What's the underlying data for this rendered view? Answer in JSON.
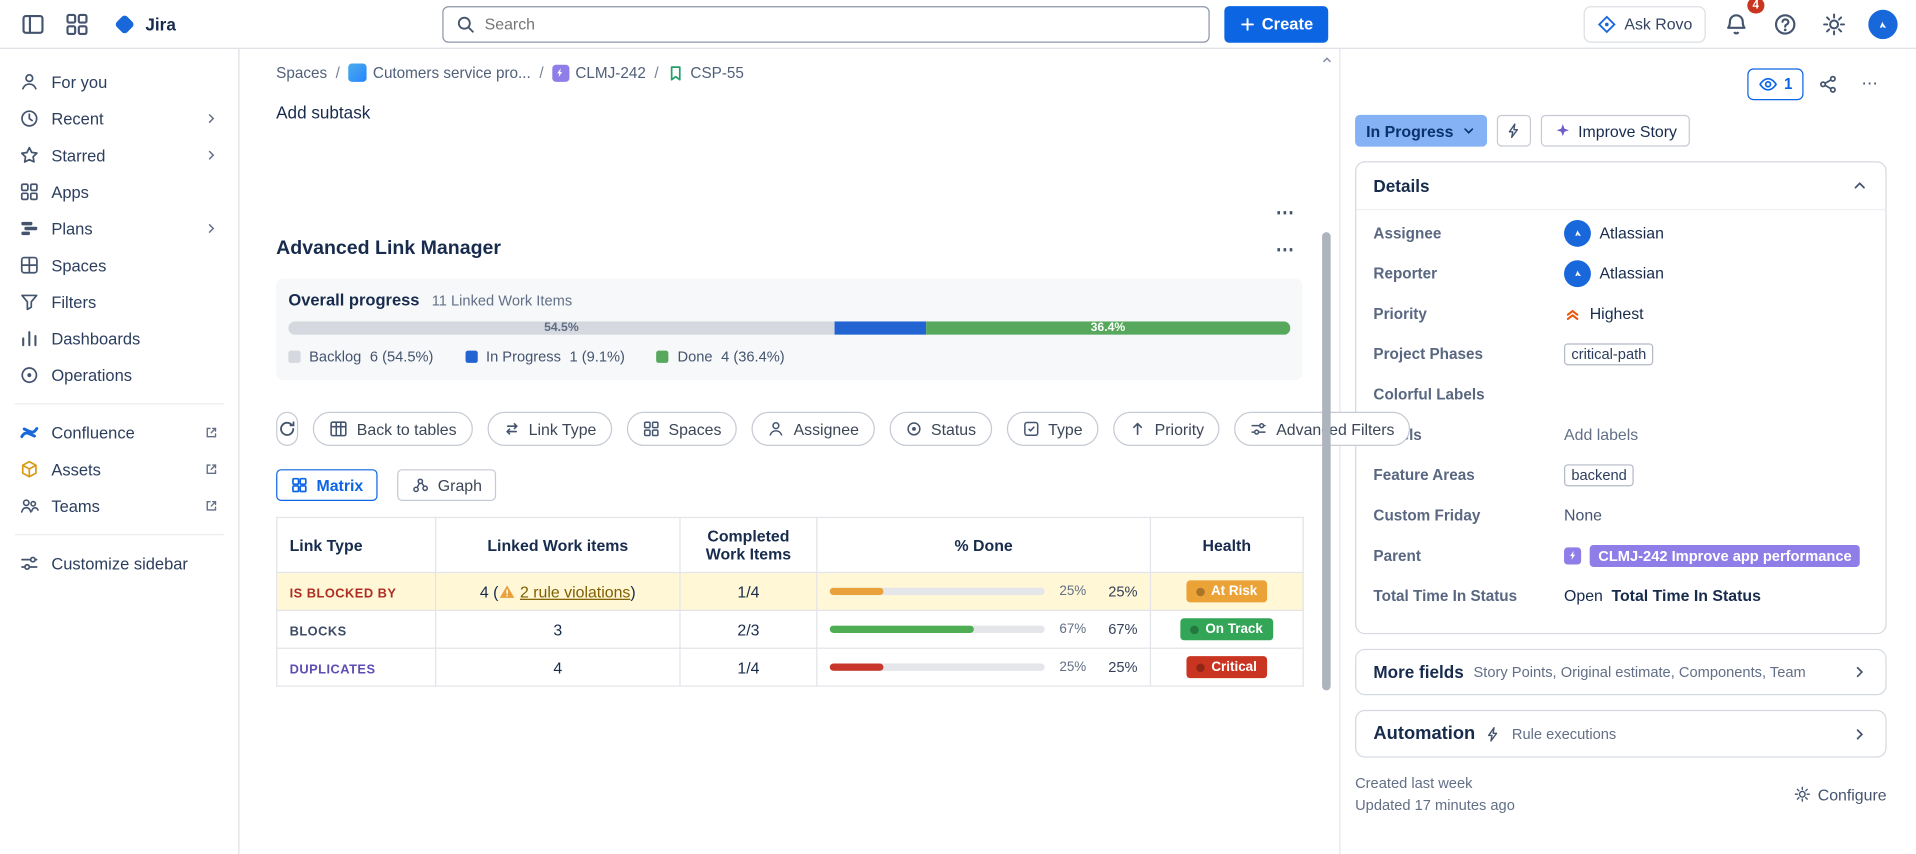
{
  "topbar": {
    "app_name": "Jira",
    "search_placeholder": "Search",
    "create_label": "Create",
    "ask_rovo_label": "Ask Rovo",
    "notification_count": "4"
  },
  "sidebar": {
    "items": [
      {
        "label": "For you"
      },
      {
        "label": "Recent"
      },
      {
        "label": "Starred"
      },
      {
        "label": "Apps"
      },
      {
        "label": "Plans"
      },
      {
        "label": "Spaces"
      },
      {
        "label": "Filters"
      },
      {
        "label": "Dashboards"
      },
      {
        "label": "Operations"
      }
    ],
    "apps": [
      {
        "label": "Confluence"
      },
      {
        "label": "Assets"
      },
      {
        "label": "Teams"
      }
    ],
    "customize_label": "Customize sidebar"
  },
  "breadcrumb": {
    "items": [
      "Spaces",
      "Cutomers service pro...",
      "CLMJ-242",
      "CSP-55"
    ]
  },
  "main": {
    "add_subtask_label": "Add subtask",
    "section_title": "Advanced Link Manager",
    "progress": {
      "title": "Overall progress",
      "count_label": "11 Linked Work Items",
      "segments": [
        {
          "name": "Backlog",
          "pct": 54.5,
          "label": "54.5%",
          "color": "#d5d9df",
          "label_color": "#5e6c84"
        },
        {
          "name": "In Progress",
          "pct": 9.1,
          "label": "",
          "color": "#2264d1",
          "label_color": "#ffffff"
        },
        {
          "name": "Done",
          "pct": 36.4,
          "label": "36.4%",
          "color": "#57a85c",
          "label_color": "#ffffff"
        }
      ],
      "legend": [
        {
          "label": "Backlog",
          "value": "6 (54.5%)",
          "color": "#d5d9df"
        },
        {
          "label": "In Progress",
          "value": "1 (9.1%)",
          "color": "#2264d1"
        },
        {
          "label": "Done",
          "value": "4 (36.4%)",
          "color": "#57a85c"
        }
      ]
    },
    "toolbar": {
      "back_to_tables_label": "Back to tables",
      "filters": [
        {
          "label": "Link Type"
        },
        {
          "label": "Spaces"
        },
        {
          "label": "Assignee"
        },
        {
          "label": "Status"
        },
        {
          "label": "Type"
        },
        {
          "label": "Priority"
        },
        {
          "label": "Advanced Filters"
        }
      ]
    },
    "views": {
      "matrix_label": "Matrix",
      "graph_label": "Graph"
    },
    "table": {
      "headers": [
        "Link Type",
        "Linked Work items",
        "Completed Work Items",
        "% Done",
        "Health"
      ],
      "rows": [
        {
          "link_type": "IS BLOCKED BY",
          "link_type_color": "#ae2e24",
          "row_bg": "#fff7d6",
          "linked_prefix": "4 (",
          "violation_link": "2 rule violations",
          "linked_suffix": ")",
          "completed": "1/4",
          "pct": 25,
          "pct_inline": "25%",
          "pct_value": "25%",
          "bar_color": "#e9a23b",
          "health": "At Risk",
          "health_bg": "#eba338"
        },
        {
          "link_type": "BLOCKS",
          "link_type_color": "#3d4b63",
          "linked": "3",
          "completed": "2/3",
          "pct": 67,
          "pct_inline": "67%",
          "pct_value": "67%",
          "bar_color": "#4fae54",
          "health": "On Track",
          "health_bg": "#33a557"
        },
        {
          "link_type": "DUPLICATES",
          "link_type_color": "#5e4db2",
          "linked": "4",
          "completed": "1/4",
          "pct": 25,
          "pct_inline": "25%",
          "pct_value": "25%",
          "bar_color": "#c9372c",
          "health": "Critical",
          "health_bg": "#ca3521"
        }
      ]
    }
  },
  "panel": {
    "watcher_count": "1",
    "status_label": "In Progress",
    "status_bg": "#85b2f4",
    "status_fg": "#09326c",
    "improve_story_label": "Improve Story",
    "details_title": "Details",
    "fields": {
      "assignee": {
        "label": "Assignee",
        "value": "Atlassian"
      },
      "reporter": {
        "label": "Reporter",
        "value": "Atlassian"
      },
      "priority": {
        "label": "Priority",
        "value": "Highest",
        "color": "#e8590c"
      },
      "project_phases": {
        "label": "Project Phases",
        "value": "critical-path"
      },
      "colorful_labels": {
        "label": "Colorful Labels",
        "value": ""
      },
      "labels": {
        "label": "Labels",
        "value": "Add labels"
      },
      "feature_areas": {
        "label": "Feature Areas",
        "value": "backend"
      },
      "custom_friday": {
        "label": "Custom Friday",
        "value": "None"
      },
      "parent": {
        "label": "Parent",
        "value": "CLMJ-242 Improve app performance",
        "badge_bg": "#8f7ee7"
      },
      "total_time": {
        "label": "Total Time In Status",
        "value_prefix": "Open",
        "value_bold": "Total Time In Status"
      }
    },
    "more_fields": {
      "title": "More fields",
      "summary": "Story Points, Original estimate, Components, Team"
    },
    "automation": {
      "title": "Automation",
      "summary": "Rule executions"
    },
    "created_label": "Created last week",
    "updated_label": "Updated 17 minutes ago",
    "configure_label": "Configure"
  }
}
